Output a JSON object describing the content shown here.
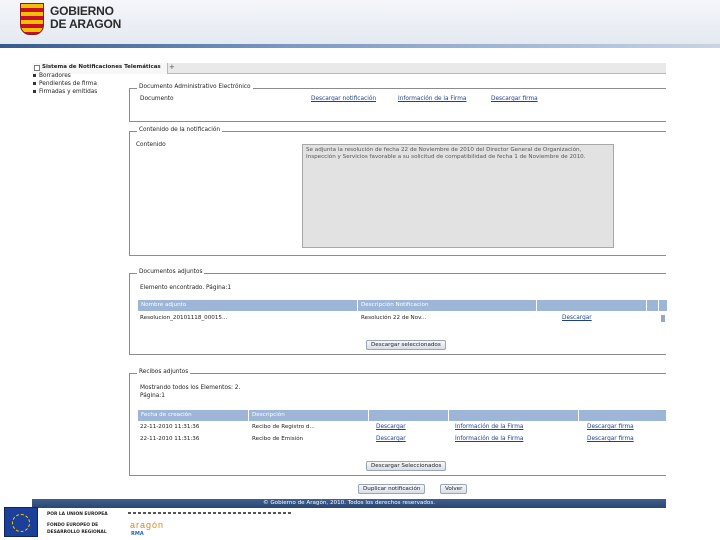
{
  "header": {
    "logo_line1": "GOBIERNO",
    "logo_line2": "DE ARAGON",
    "accent": "#355a8c"
  },
  "browser": {
    "tab_label": "Sistema de Notificaciones Telemáticas",
    "new_tab_label": "+"
  },
  "sidebar": {
    "items": [
      {
        "label": "Borradores"
      },
      {
        "label": "Pendientes de firma"
      },
      {
        "label": "Firmadas y emitidas"
      }
    ]
  },
  "doc_admin": {
    "legend": "Documento Administrativo Electrónico",
    "row_label": "Documento",
    "link_download": "Descargar notificación",
    "link_info": "Información de la Firma",
    "link_sig": "Descargar firma"
  },
  "content": {
    "legend": "Contenido de la notificación",
    "label": "Contenido",
    "text": "Se adjunta la resolución de fecha 22 de Noviembre de 2010 del Director General de Organización, Inspección y Servicios favorable a su solicitud de compatibilidad de fecha 1 de Noviembre de 2010."
  },
  "attachments": {
    "legend": "Documentos adjuntos",
    "found_text": "Elemento encontrado. Página:1",
    "columns": [
      "Nombre adjunto",
      "Descripción Notificacion"
    ],
    "rows": [
      {
        "name": "Resolucion_20101118_00015...",
        "desc": "Resolución 22 de Nov...",
        "action": "Descargar"
      }
    ],
    "button": "Descargar seleccionados"
  },
  "receipts": {
    "legend": "Recibos adjuntos",
    "found_text": "Mostrando todos los Elementos: 2.",
    "page_text": "Página:1",
    "columns": [
      "Fecha de creación",
      "Descripción"
    ],
    "rows": [
      {
        "date": "22-11-2010 11:31:36",
        "desc": "Recibo de Registro d...",
        "download": "Descargar",
        "info": "Información de la Firma",
        "sig": "Descargar firma"
      },
      {
        "date": "22-11-2010 11:31:36",
        "desc": "Recibo de Emisión",
        "download": "Descargar",
        "info": "Información de la Firma",
        "sig": "Descargar firma"
      }
    ],
    "button": "Descargar Seleccionados"
  },
  "actions": {
    "duplicate": "Duplicar notificación",
    "back": "Volver"
  },
  "footer": {
    "copyright": "© Gobierno de Aragón, 2010. Todos los derechos reservados.",
    "eu_line1": "POR LA UNION EUROPEA",
    "eu_line2": "FONDO EUROPEO DE",
    "eu_line3": "DESARROLLO REGIONAL",
    "logo2": "aragón",
    "logo3": "RMA"
  }
}
